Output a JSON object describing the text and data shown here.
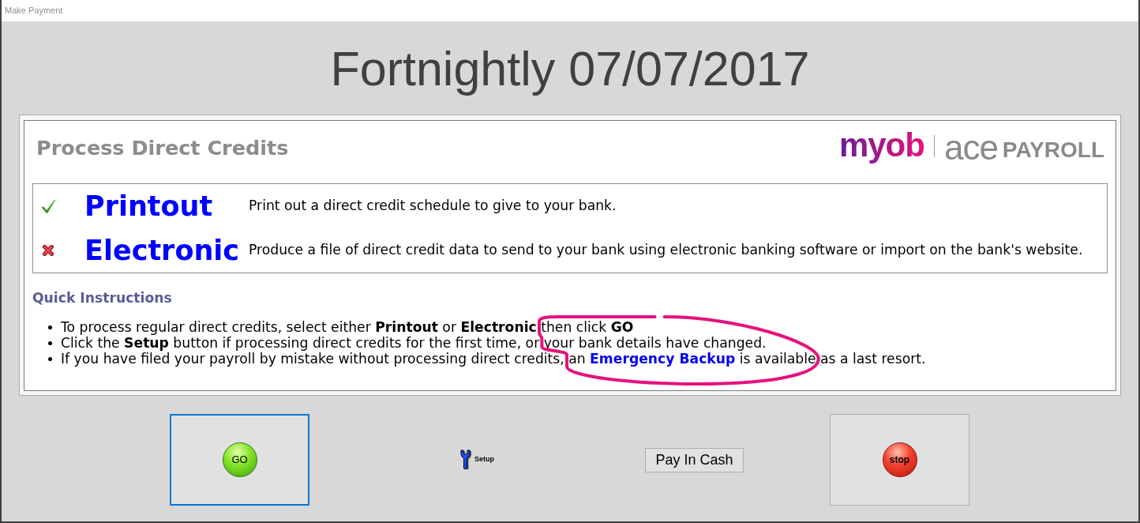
{
  "window": {
    "title": "Make Payment"
  },
  "heading": "Fortnightly 07/07/2017",
  "panel": {
    "title": "Process Direct Credits",
    "logo": {
      "brand": "myob",
      "product": "ace",
      "product_suffix": "PAYROLL"
    }
  },
  "options": [
    {
      "label": "Printout",
      "description": "Print out a direct credit schedule to give to your bank.",
      "selected": true
    },
    {
      "label": "Electronic",
      "description": "Produce a file of direct credit data to send to your bank using electronic banking software or import on the bank's website.",
      "selected": false
    }
  ],
  "instructions": {
    "title": "Quick Instructions",
    "items": [
      {
        "text": "To process regular direct credits, select either **Printout** or **Electronic** then click **GO**"
      },
      {
        "text": "Click the **Setup** button if processing direct credits for the first time, or your bank details have changed."
      },
      {
        "text": "If you have filed your payroll by mistake without processing direct credits, an ",
        "link": "Emergency Backup",
        "text_after": " is available as a last resort."
      }
    ]
  },
  "buttons": [
    {
      "kind": "go",
      "label": "GO",
      "focused": true
    },
    {
      "kind": "setup",
      "label": "Setup",
      "focused": false
    },
    {
      "kind": "cash",
      "label": "Pay In Cash",
      "focused": false
    },
    {
      "kind": "stop",
      "label": "stop",
      "focused": false
    }
  ]
}
